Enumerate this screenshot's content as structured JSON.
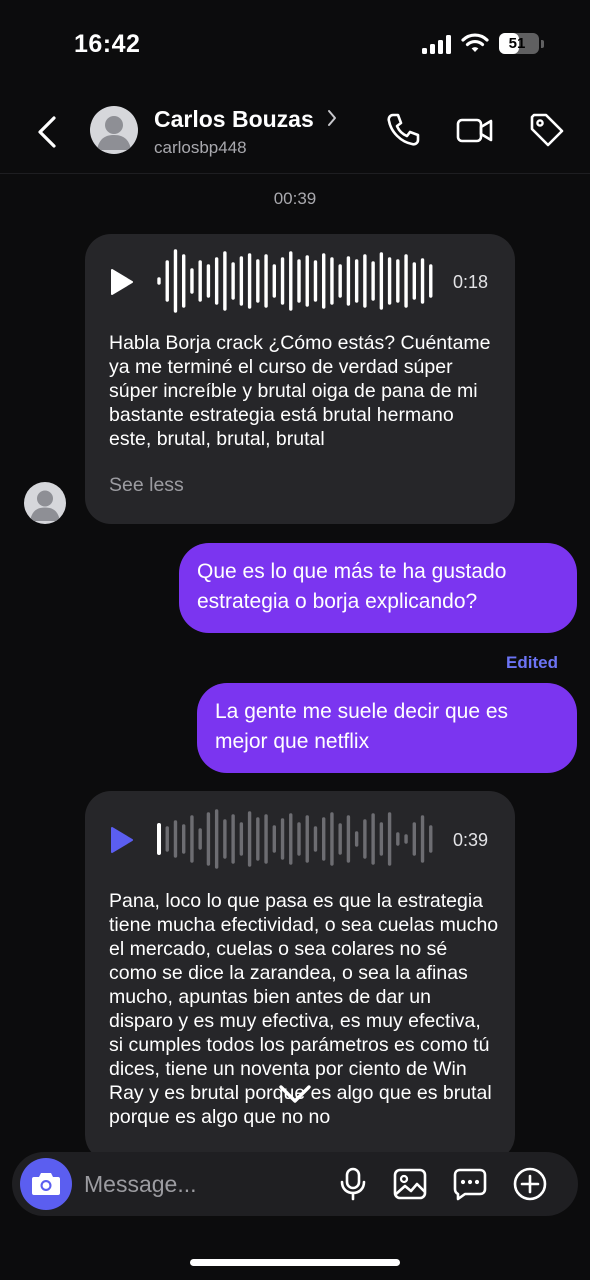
{
  "status_bar": {
    "time": "16:42",
    "battery": "51",
    "battery_level": 0.51
  },
  "header": {
    "name": "Carlos Bouzas",
    "username": "carlosbp448",
    "icons": [
      "back-icon",
      "avatar",
      "chevron-right-icon",
      "phone-icon",
      "video-camera-icon",
      "tag-icon"
    ]
  },
  "chat": {
    "timestamp": "00:39",
    "messages": [
      {
        "type": "voice-incoming",
        "duration": "0:18",
        "transcript": "Habla Borja crack ¿Cómo estás? Cuéntame ya me terminé el curso de verdad súper súper increíble y brutal oiga de pana de mi bastante estrategia está brutal hermano este, brutal, brutal, brutal",
        "see_less": "See less",
        "progress": 0
      },
      {
        "type": "text-outgoing",
        "text": "Que es lo que más te ha gustado estrategia o borja explicando?"
      },
      {
        "type": "label",
        "text": "Edited"
      },
      {
        "type": "text-outgoing",
        "text": "La gente me suele decir que es mejor que netflix"
      },
      {
        "type": "voice-incoming",
        "duration": "0:39",
        "transcript": "Pana, loco lo que pasa es que la estrategia tiene mucha efectividad, o sea cuelas mucho el mercado, cuelas o sea colares no sé como se dice la zarandea, o sea la afinas mucho, apuntas bien antes de dar un disparo y es muy efectiva, es muy efectiva, si cumples todos los parámetros es como tú dices, tiene un noventa por ciento de Win Ray y es brutal porque es algo que es brutal porque es algo que no no",
        "progress": 0
      }
    ]
  },
  "composer": {
    "placeholder": "Message...",
    "icons": [
      "camera-icon",
      "microphone-icon",
      "image-icon",
      "chat-more-icon",
      "plus-circle-icon"
    ]
  },
  "colors": {
    "background": "#0c0c0d",
    "incoming_bubble": "#262629",
    "outgoing_bubble": "#7b35f0",
    "accent": "#5b5ef0",
    "edited": "#6c74f5"
  }
}
